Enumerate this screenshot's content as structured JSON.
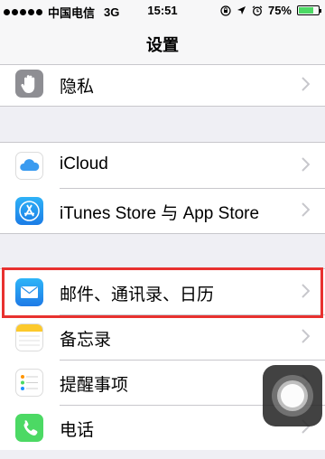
{
  "status_bar": {
    "carrier": "中国电信",
    "network": "3G",
    "time": "15:51",
    "battery_text": "75%",
    "battery_level": 0.75
  },
  "nav": {
    "title": "设置"
  },
  "settings": {
    "privacy": "隐私",
    "icloud": "iCloud",
    "itunes": "iTunes Store 与 App Store",
    "mail": "邮件、通讯录、日历",
    "notes": "备忘录",
    "reminders": "提醒事项",
    "phone": "电话"
  },
  "colors": {
    "highlight_border": "#e8312f",
    "battery_fill": "#4cd964",
    "phone_icon_bg": "#4cd964"
  }
}
